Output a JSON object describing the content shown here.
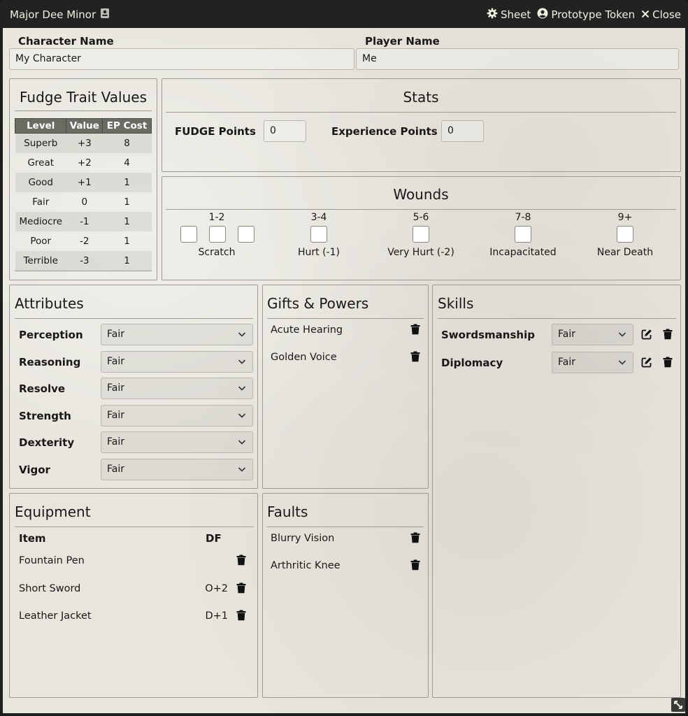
{
  "window": {
    "title": "Major Dee Minor",
    "controls": {
      "sheet": "Sheet",
      "token": "Prototype Token",
      "close": "Close"
    }
  },
  "character": {
    "name_label": "Character Name",
    "name_value": "My Character",
    "player_label": "Player Name",
    "player_value": "Me"
  },
  "trait_values": {
    "heading": "Fudge Trait Values",
    "columns": [
      "Level",
      "Value",
      "EP Cost"
    ],
    "rows": [
      [
        "Superb",
        "+3",
        "8"
      ],
      [
        "Great",
        "+2",
        "4"
      ],
      [
        "Good",
        "+1",
        "1"
      ],
      [
        "Fair",
        "0",
        "1"
      ],
      [
        "Mediocre",
        "-1",
        "1"
      ],
      [
        "Poor",
        "-2",
        "1"
      ],
      [
        "Terrible",
        "-3",
        "1"
      ]
    ]
  },
  "stats": {
    "heading": "Stats",
    "fudge_label": "FUDGE Points",
    "fudge_value": "0",
    "xp_label": "Experience Points",
    "xp_value": "0"
  },
  "wounds": {
    "heading": "Wounds",
    "columns": [
      {
        "range": "1-2",
        "label": "Scratch"
      },
      {
        "range": "3-4",
        "label": "Hurt (-1)"
      },
      {
        "range": "5-6",
        "label": "Very Hurt (-2)"
      },
      {
        "range": "7-8",
        "label": "Incapacitated"
      },
      {
        "range": "9+",
        "label": "Near Death"
      }
    ]
  },
  "attributes": {
    "heading": "Attributes",
    "items": [
      {
        "name": "Perception",
        "value": "Fair"
      },
      {
        "name": "Reasoning",
        "value": "Fair"
      },
      {
        "name": "Resolve",
        "value": "Fair"
      },
      {
        "name": "Strength",
        "value": "Fair"
      },
      {
        "name": "Dexterity",
        "value": "Fair"
      },
      {
        "name": "Vigor",
        "value": "Fair"
      }
    ]
  },
  "gifts": {
    "heading": "Gifts & Powers",
    "items": [
      "Acute Hearing",
      "Golden Voice"
    ]
  },
  "skills": {
    "heading": "Skills",
    "items": [
      {
        "name": "Swordsmanship",
        "value": "Fair"
      },
      {
        "name": "Diplomacy",
        "value": "Fair"
      }
    ]
  },
  "equipment": {
    "heading": "Equipment",
    "item_col": "Item",
    "df_col": "DF",
    "items": [
      {
        "name": "Fountain Pen",
        "df": ""
      },
      {
        "name": "Short Sword",
        "df": "O+2"
      },
      {
        "name": "Leather Jacket",
        "df": "D+1"
      }
    ]
  },
  "faults": {
    "heading": "Faults",
    "items": [
      "Blurry Vision",
      "Arthritic Knee"
    ]
  },
  "icons": {
    "trash": "trash-icon",
    "edit": "edit-icon",
    "gear": "gear-icon",
    "user": "user-circle-icon",
    "close": "close-icon",
    "resize": "resize-icon"
  }
}
